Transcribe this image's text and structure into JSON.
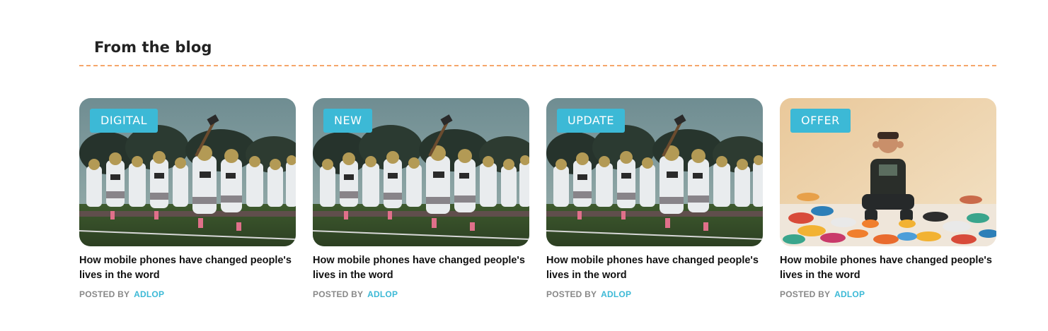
{
  "section": {
    "title": "From the blog"
  },
  "posts": [
    {
      "tag": "DIGITAL",
      "image": "football-team-photo",
      "title": "How mobile phones have changed people's lives in the word",
      "posted_by_label": "POSTED BY",
      "author": "ADLOP"
    },
    {
      "tag": "NEW",
      "image": "football-team-photo",
      "title": "How mobile phones have changed people's lives in the word",
      "posted_by_label": "POSTED BY",
      "author": "ADLOP"
    },
    {
      "tag": "UPDATE",
      "image": "football-team-photo",
      "title": "How mobile phones have changed people's lives in the word",
      "posted_by_label": "POSTED BY",
      "author": "ADLOP"
    },
    {
      "tag": "OFFER",
      "image": "sneakers-collection-photo",
      "title": "How mobile phones have changed people's lives in the word",
      "posted_by_label": "POSTED BY",
      "author": "ADLOP"
    }
  ],
  "colors": {
    "accent": "#3cb9d6",
    "divider": "#f5a66a",
    "title_text": "#111111",
    "meta_text": "#888888"
  }
}
